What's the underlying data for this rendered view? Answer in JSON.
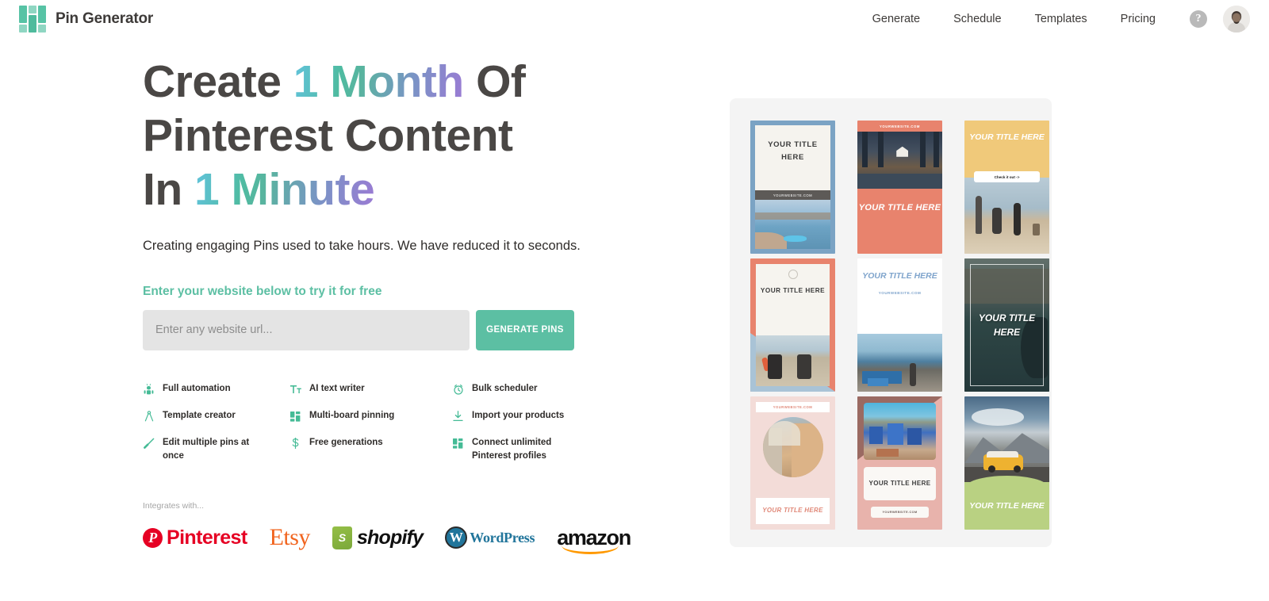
{
  "header": {
    "brand": "Pin Generator",
    "logo_icon": "pin-generator-logo-icon",
    "nav": [
      {
        "label": "Generate"
      },
      {
        "label": "Schedule"
      },
      {
        "label": "Templates"
      },
      {
        "label": "Pricing"
      }
    ],
    "help_icon": "question-mark-icon",
    "help_label": "?",
    "avatar_icon": "user-avatar"
  },
  "hero": {
    "headline_part1": "Create ",
    "headline_accent1": "1 Month",
    "headline_part2": " Of Pinterest Content In ",
    "headline_accent2": "1 Minute",
    "subtitle": "Creating engaging Pins used to take hours. We have reduced it to seconds.",
    "cta_label": "Enter your website below to try it for free",
    "input_placeholder": "Enter any website url...",
    "input_value": "",
    "generate_button": "GENERATE PINS",
    "accent_green": "#5cbfa3",
    "gradient_colors": [
      "#62c3dd",
      "#4fbba1",
      "#7b93c6",
      "#9b7ad4"
    ]
  },
  "features": [
    {
      "label": "Full automation",
      "icon": "robot-icon"
    },
    {
      "label": "AI text writer",
      "icon": "text-tool-icon"
    },
    {
      "label": "Bulk scheduler",
      "icon": "alarm-clock-icon"
    },
    {
      "label": "Template creator",
      "icon": "compass-icon"
    },
    {
      "label": "Multi-board pinning",
      "icon": "grid-layout-icon"
    },
    {
      "label": "Import your products",
      "icon": "download-icon"
    },
    {
      "label": "Edit multiple pins at once",
      "icon": "brush-icon"
    },
    {
      "label": "Free generations",
      "icon": "dollar-icon"
    },
    {
      "label": "Connect unlimited Pinterest profiles",
      "icon": "grid-layout-icon"
    }
  ],
  "integrations": {
    "label": "Integrates with...",
    "logos": [
      {
        "name": "Pinterest",
        "mark": "P"
      },
      {
        "name": "Etsy"
      },
      {
        "name": "shopify",
        "mark": "S"
      },
      {
        "name": "WordPress",
        "mark": "W"
      },
      {
        "name": "amazon"
      }
    ]
  },
  "board": {
    "pins": [
      {
        "title": "YOUR TITLE HERE",
        "url": "YOURWEBSITE.COM"
      },
      {
        "title": "YOUR TITLE HERE",
        "url": "YOURWEBSITE.COM"
      },
      {
        "title": "YOUR TITLE HERE",
        "cta": "Check it out ->"
      },
      {
        "title": "YOUR TITLE HERE"
      },
      {
        "title": "YOUR TITLE HERE",
        "url": "YOURWEBSITE.COM"
      },
      {
        "title": "YOUR TITLE HERE"
      },
      {
        "title": "YOUR TITLE HERE",
        "url": "YOURWEBSITE.COM"
      },
      {
        "title": "YOUR TITLE HERE",
        "url": "YOURWEBSITE.COM"
      },
      {
        "title": "YOUR TITLE HERE"
      }
    ]
  }
}
